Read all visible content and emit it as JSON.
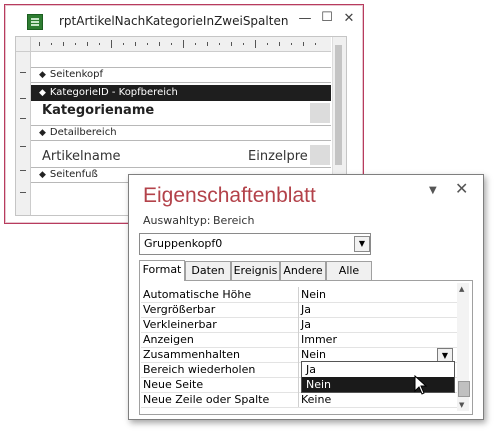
{
  "report_window": {
    "title": "rptArtikelNachKategorieInZweiSpalten",
    "controls": {
      "minimize": "—",
      "maximize": "☐",
      "close": "✕"
    },
    "sections": {
      "page_header": "Seitenkopf",
      "group_header": "KategorieID - Kopfbereich",
      "detail": "Detailbereich",
      "page_footer": "Seitenfuß"
    },
    "fields": {
      "category_name": "Kategoriename",
      "article_name": "Artikelname",
      "unit_price": "Einzelprei"
    }
  },
  "property_sheet": {
    "title": "Eigenschaftenblatt",
    "selection_type_label": "Auswahltyp:",
    "selection_type_value": "Bereich",
    "object_selected": "Gruppenkopf0",
    "tabs": [
      {
        "label": "Format",
        "active": true
      },
      {
        "label": "Daten",
        "active": false
      },
      {
        "label": "Ereignis",
        "active": false
      },
      {
        "label": "Andere",
        "active": false
      },
      {
        "label": "Alle",
        "active": false
      }
    ],
    "properties": [
      {
        "name": "Automatische Höhe",
        "value": "Nein"
      },
      {
        "name": "Vergrößerbar",
        "value": "Ja"
      },
      {
        "name": "Verkleinerbar",
        "value": "Ja"
      },
      {
        "name": "Anzeigen",
        "value": "Immer"
      },
      {
        "name": "Zusammenhalten",
        "value": "Nein"
      },
      {
        "name": "Bereich wiederholen",
        "value": ""
      },
      {
        "name": "Neue Seite",
        "value": ""
      },
      {
        "name": "Neue Zeile oder Spalte",
        "value": "Keine"
      }
    ],
    "dropdown_options": [
      {
        "label": "Ja",
        "selected": false
      },
      {
        "label": "Nein",
        "selected": true
      }
    ],
    "close_icon": "✕",
    "menu_icon": "▼"
  },
  "colors": {
    "accent_title": "#b3424a",
    "window_border": "#b83b5e",
    "selected_bar": "#1e1e1e"
  }
}
